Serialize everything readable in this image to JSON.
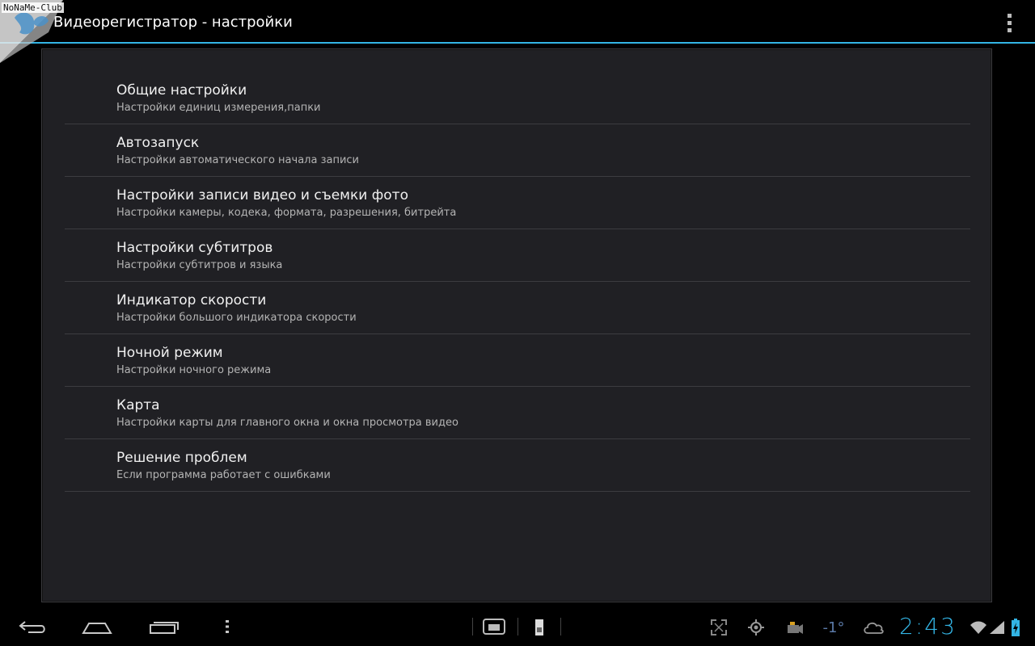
{
  "action_bar": {
    "title": "Видеорегистратор - настройки",
    "overflow_icon": "overflow-menu-icon"
  },
  "watermark": {
    "text": "NoNaMe-Club"
  },
  "settings": {
    "items": [
      {
        "title": "Общие настройки",
        "summary": "Настройки единиц измерения,папки"
      },
      {
        "title": "Автозапуск",
        "summary": "Настройки автоматического начала записи"
      },
      {
        "title": "Настройки записи видео и съемки фото",
        "summary": "Настройки камеры, кодека, формата, разрешения, битрейта"
      },
      {
        "title": "Настройки субтитров",
        "summary": "Настройки субтитров и языка"
      },
      {
        "title": "Индикатор скорости",
        "summary": "Настройки большого индикатора скорости"
      },
      {
        "title": "Ночной режим",
        "summary": "Настройки ночного режима"
      },
      {
        "title": "Карта",
        "summary": "Настройки карты для главного окна и окна просмотра видео"
      },
      {
        "title": "Решение проблем",
        "summary": "Если программа работает с ошибками"
      }
    ]
  },
  "system_bar": {
    "clock": "2:43",
    "icons": [
      "back-icon",
      "home-icon",
      "recent-apps-icon",
      "menu-icon",
      "screen-compat-icon",
      "usb-icon",
      "fullscreen-icon",
      "gps-icon",
      "camera-icon",
      "temperature-icon",
      "cloud-icon",
      "wifi-icon",
      "signal-icon",
      "battery-icon"
    ],
    "temperature": "-1°"
  },
  "colors": {
    "accent": "#33b5e5",
    "panel_bg": "#202024",
    "divider": "#3c3c40"
  }
}
